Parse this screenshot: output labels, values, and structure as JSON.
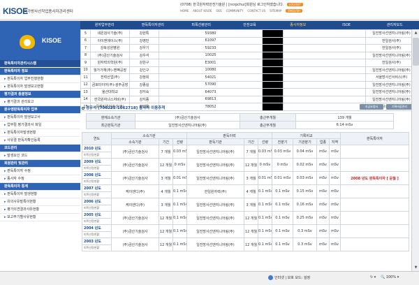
{
  "header": {
    "logo": "KISOE",
    "org_name": "국가방사선작업종사자관리센터",
    "user_prefix": "(0708) 한국원자력안전기술원 | [ncrpchui]회원님 로그인하였습니다.",
    "user_badge": "LOGOUT",
    "links": [
      "HOME",
      "ABOUT KISOE",
      "OES",
      "COMMUNITY",
      "CONTACT US",
      "SITEMAP",
      "ENGLISH"
    ]
  },
  "nav": [
    "원자업무관리",
    "판독특이자관리",
    "피폭선량관리",
    "안전교육",
    "종사자정보",
    "ISOE",
    "관리자모드"
  ],
  "sidebar": {
    "brand": "KISOE",
    "title": "판독특이자관리시스템",
    "menu": [
      {
        "type": "sec",
        "label": "판독특이자 정보"
      },
      {
        "type": "sub",
        "label": "판독특이자 업무진행현황"
      },
      {
        "type": "sub",
        "label": "판독특이자 발생보고현황"
      },
      {
        "type": "sec",
        "label": "평가결과 총괄정보"
      },
      {
        "type": "sub",
        "label": "평가결과 관리보고"
      },
      {
        "type": "sec",
        "label": "원수영판독특이자 업무"
      },
      {
        "type": "sub",
        "label": "판독특이자 발생보고서"
      },
      {
        "type": "sub",
        "label": "업무절 평가결과서 화일"
      },
      {
        "type": "sub",
        "label": "판독특이자발생현황"
      },
      {
        "type": "sub",
        "label": "사유결 판독자확인등록"
      },
      {
        "type": "sec",
        "label": "코드관리"
      },
      {
        "type": "sub",
        "label": "발생요인 코드"
      },
      {
        "type": "sec",
        "label": "회원관리 및관리"
      },
      {
        "type": "sub",
        "label": "판독특이자 수정"
      },
      {
        "type": "sub",
        "label": "종사자 수정"
      },
      {
        "type": "sec",
        "label": "판독특이자 통계"
      },
      {
        "type": "sub",
        "label": "판독특이자 발생현황"
      },
      {
        "type": "sub",
        "label": "유의사유발특이현황"
      },
      {
        "type": "sub",
        "label": "평가의견결과사유현황"
      },
      {
        "type": "sub",
        "label": "보고주기별사유현황"
      }
    ]
  },
  "list_rows": [
    [
      "5",
      "네온검사기술(주)",
      "강원특",
      "59380",
      "일진방사선엔지니어링(주)"
    ],
    [
      "6",
      "이이엔에이스(주)",
      "강영민",
      "61097",
      "한일검사(주)"
    ],
    [
      "7",
      "강북성원병원",
      "강우기",
      "59233",
      "한일검사(주)"
    ],
    [
      "8",
      "(주)금산기술검사",
      "강우석",
      "10025",
      "일진방사선엔지니어링(주)"
    ],
    [
      "9",
      "원자력의학원(주)",
      "강원구",
      "E3001",
      "한일검사(주)"
    ],
    [
      "10",
      "월가가재(주)-맨팩공장",
      "강인구",
      "10080",
      "일진방사선엔지니어링(주)"
    ],
    [
      "11",
      "전력산업(주)",
      "강정희",
      "54021",
      "서울방사선서비스(주)"
    ],
    [
      "12",
      "금호타이어(주)-광주공장",
      "강종실",
      "57090",
      "일진방사선엔지니어링(주)"
    ],
    [
      "13",
      "울산대학교",
      "강지숙",
      "64073",
      "일진방사선엔지니어링(주)"
    ],
    [
      "14",
      "한국원자녀스처비(주)",
      "강지종",
      "69813",
      "일진방사선엔지니어링(주)"
    ],
    [
      "15",
      "국제비원검검사(주)",
      "강태용",
      "78052",
      "일진방사선엔지니어링(주)"
    ]
  ],
  "detail": {
    "title": "경우석 [700225-1062718] 종사자 이동추적",
    "btn1": "지급요청서",
    "btn2": "기록바꿈관리",
    "summary": [
      {
        "label": "현재소속기관",
        "value": "(주)금산기술검사",
        "label2": "총근무개월",
        "value2": "139 개월"
      },
      {
        "label": "최근판독기관",
        "value": "일진방사선엔지니어링(주)",
        "label2": "총근무개월",
        "value2": "6.14 mSv"
      }
    ]
  },
  "history": {
    "h_year": "연도",
    "h_org_group": "소속기관",
    "h_read_group": "판독이력",
    "h_record_group": "기록비교",
    "h_special": "판독특이자",
    "h_org": "소속기관",
    "h_period": "기간",
    "h_dose": "선량",
    "h_read_org": "판독기관",
    "h_period2": "기간",
    "h_dose2": "선량",
    "h_prev": "전분기",
    "h_plan": "기관분기",
    "h_work": "업종",
    "h_area": "지역",
    "rows": [
      {
        "year": "2010 년도",
        "sub": "피폭선량현황",
        "org": "(주)금산기술검사",
        "p1": "7 개월",
        "d1": "0.03 mSv",
        "ro": "일진방사선엔지니어링(주)",
        "p2": "7 개월",
        "d2": "0.03 mSv",
        "c1": "0.03 mSv",
        "c2": "0.04 mSv",
        "c3": "mSv",
        "c4": "mSv",
        "sp": ""
      },
      {
        "year": "2009 년도",
        "sub": "피폭선량현황",
        "org": "(주)금산기술검사",
        "p1": "12 개월",
        "d1": "0 mSv",
        "ro": "일진방사선엔지니어링(주)",
        "p2": "12 개월",
        "d2": "0 mSv",
        "c1": "0 mSv",
        "c2": "0.02 mSv",
        "c3": "mSv",
        "c4": "mSv",
        "sp": ""
      },
      {
        "year": "2008 년도",
        "sub": "피폭선량현황",
        "org": "(주)금산기술검사",
        "p1": "3 개월",
        "d1": "0.01 mSv",
        "ro": "일진방사선엔지니어링(주)",
        "p2": "3 개월",
        "d2": "0.01 mSv",
        "c1": "0.01 mSv",
        "c2": "0.03 mSv",
        "c3": "mSv",
        "c4": "mSv",
        "sp": "2008 년도 판독특이자 [ 문월 ]"
      },
      {
        "year": "2007 년도",
        "sub": "피폭선량현황",
        "org": "케이엔디(주)",
        "p1": "4 개월",
        "d1": "0.1 mSv",
        "ro": "한일원자력(주)",
        "p2": "4 개월",
        "d2": "0.1 mSv",
        "c1": "0.1 mSv",
        "c2": "0.15 mSv",
        "c3": "mSv",
        "c4": "mSv",
        "sp": ""
      },
      {
        "year": "2006 년도",
        "sub": "피폭선량현황",
        "org": "케이엔디(주)",
        "p1": "3 개월",
        "d1": "0.1 mSv",
        "ro": "일진방사선엔지니어링(주)",
        "p2": "3 개월",
        "d2": "0.1 mSv",
        "c1": "0.1 mSv",
        "c2": "0.16 mSv",
        "c3": "mSv",
        "c4": "mSv",
        "sp": ""
      },
      {
        "year": "2005 년도",
        "sub": "피폭선량현황",
        "org": "(주)금산기술검사",
        "p1": "12 개월",
        "d1": "0.1 mSv",
        "ro": "일진방사선엔지니어링(주)",
        "p2": "12 개월",
        "d2": "0.1 mSv",
        "c1": "0.1 mSv",
        "c2": "0.25 mSv",
        "c3": "mSv",
        "c4": "mSv",
        "sp": ""
      },
      {
        "year": "2004 년도",
        "sub": "피폭선량현황",
        "org": "(주)금산기술검사",
        "p1": "12 개월",
        "d1": "0.1 mSv",
        "ro": "일진방사선엔지니어링(주)",
        "p2": "12 개월",
        "d2": "0.1 mSv",
        "c1": "0.1 mSv",
        "c2": "0.3 mSv",
        "c3": "mSv",
        "c4": "mSv",
        "sp": ""
      },
      {
        "year": "2003 년도",
        "sub": "피폭선량현황",
        "org": "(주)금산기술검사",
        "p1": "12 개월",
        "d1": "0.1 mSv",
        "ro": "일진방사선엔지니어링(주)",
        "p2": "12 개월",
        "d2": "0.1 mSv",
        "c1": "0.1 mSv",
        "c2": "0.3 mSv",
        "c3": "mSv",
        "c4": "mSv",
        "sp": ""
      }
    ]
  },
  "status": {
    "zone": "인터넷 | 보호 모드: 설정",
    "tool": "↻ ▾",
    "zoom": "🔍 100% ▾"
  }
}
